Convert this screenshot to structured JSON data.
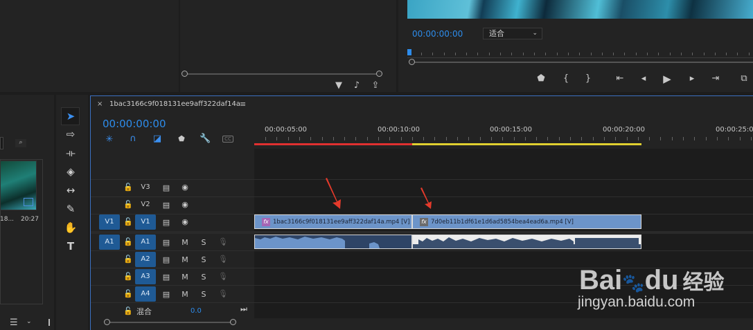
{
  "program_monitor": {
    "timecode": "00:00:00:00",
    "fit_select": "适合",
    "transport": [
      "marker-icon",
      "in-point-icon",
      "out-point-icon",
      "go-to-in-icon",
      "step-back-icon",
      "play-icon",
      "step-forward-icon",
      "go-to-out-icon",
      "export-frame-icon"
    ]
  },
  "project": {
    "item_label": "18...",
    "item_duration": "20:27"
  },
  "timeline": {
    "tab_name": "1bac3166c9f018131ee9aff322daf14a",
    "close_label": "×",
    "menu_label": "≡",
    "timecode": "00:00:00:00",
    "ruler": [
      "00:00:05:00",
      "00:00:10:00",
      "00:00:15:00",
      "00:00:20:00",
      "00:00:25:0"
    ],
    "video_tracks": [
      {
        "source": "",
        "name": "V3"
      },
      {
        "source": "",
        "name": "V2"
      },
      {
        "source": "V1",
        "name": "V1"
      }
    ],
    "audio_tracks": [
      {
        "source": "A1",
        "name": "A1",
        "m": "M",
        "s": "S"
      },
      {
        "source": "",
        "name": "A2",
        "m": "M",
        "s": "S"
      },
      {
        "source": "",
        "name": "A3",
        "m": "M",
        "s": "S"
      },
      {
        "source": "",
        "name": "A4",
        "m": "M",
        "s": "S"
      }
    ],
    "mix": {
      "label": "混合",
      "value": "0.0"
    },
    "clips": [
      {
        "fx": "fx",
        "name": "1bac3166c9f018131ee9aff322daf14a.mp4 [V]"
      },
      {
        "fx": "fx",
        "name": "7d0eb11b1df61e1d6ad5854bea4ead6a.mp4 [V]"
      }
    ]
  },
  "watermark": {
    "brand": "Bai",
    "brand2": "du",
    "cn": "经验",
    "url": "jingyan.baidu.com"
  },
  "colors": {
    "accent": "#2d8ceb",
    "track_on": "#1f5a95",
    "clip": "#6c94c9",
    "red_bar": "#e03030",
    "yellow_bar": "#e0d030",
    "arrow": "#e53a2b"
  }
}
